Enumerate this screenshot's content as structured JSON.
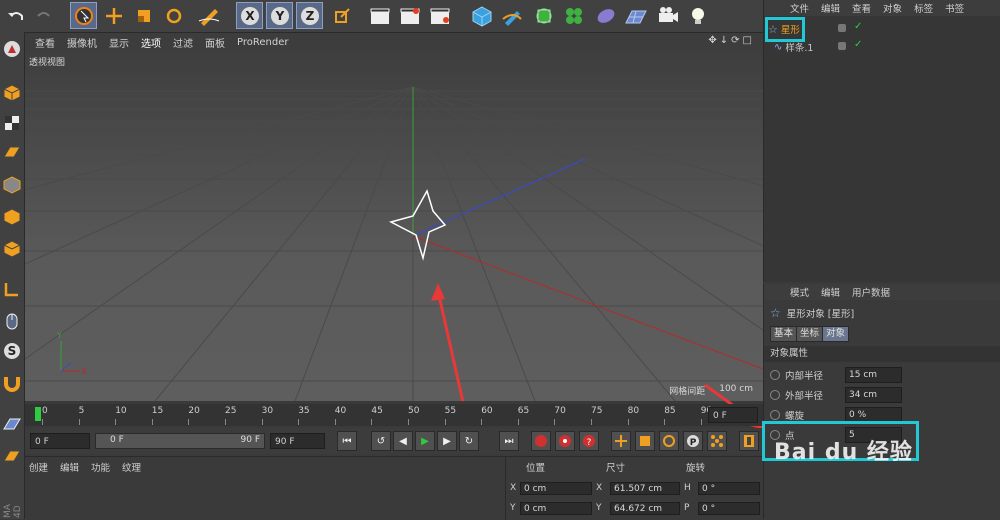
{
  "viewport_menu": [
    "查看",
    "摄像机",
    "显示",
    "选项",
    "过滤",
    "面板",
    "ProRender"
  ],
  "viewport_label": "透视视图",
  "grid_spacing": {
    "label": "网格间距",
    "value": "100 cm"
  },
  "timeline": {
    "ticks": [
      "0",
      "5",
      "10",
      "15",
      "20",
      "25",
      "30",
      "35",
      "40",
      "45",
      "50",
      "55",
      "60",
      "65",
      "70",
      "75",
      "80",
      "85",
      "90"
    ],
    "current_frame": "0 F"
  },
  "controls": {
    "start_frame": "0 F",
    "range_start": "0 F",
    "range_end": "90 F",
    "end_frame": "90 F"
  },
  "material_menu": [
    "创建",
    "编辑",
    "功能",
    "纹理"
  ],
  "coord": {
    "headers": [
      "位置",
      "尺寸",
      "旋转"
    ],
    "rows": [
      {
        "axis": "X",
        "pos": "0 cm",
        "size_axis": "X",
        "size": "61.507 cm",
        "rot_axis": "H",
        "rot": "0 °"
      },
      {
        "axis": "Y",
        "pos": "0 cm",
        "size_axis": "Y",
        "size": "64.672 cm",
        "rot_axis": "P",
        "rot": "0 °"
      }
    ]
  },
  "object_manager": {
    "menu": [
      "文件",
      "编辑",
      "查看",
      "对象",
      "标签",
      "书签"
    ],
    "objects": [
      {
        "name": "星形"
      },
      {
        "name": "样条.1"
      }
    ]
  },
  "attr_manager": {
    "menu": [
      "模式",
      "编辑",
      "用户数据"
    ],
    "title": "星形对象 [星形]",
    "tabs": [
      "基本",
      "坐标",
      "对象"
    ],
    "section": "对象属性",
    "props": [
      {
        "label": "内部半径",
        "value": "15 cm"
      },
      {
        "label": "外部半径",
        "value": "34 cm"
      },
      {
        "label": "螺旋",
        "value": "0 %"
      },
      {
        "label": "点",
        "value": "5"
      }
    ]
  },
  "watermark": "Bai du 经验",
  "side_label": "MA 4D",
  "colors": {
    "highlight": "#22c8d6",
    "arrow": "#e83838",
    "selected": "#5a6a86"
  }
}
